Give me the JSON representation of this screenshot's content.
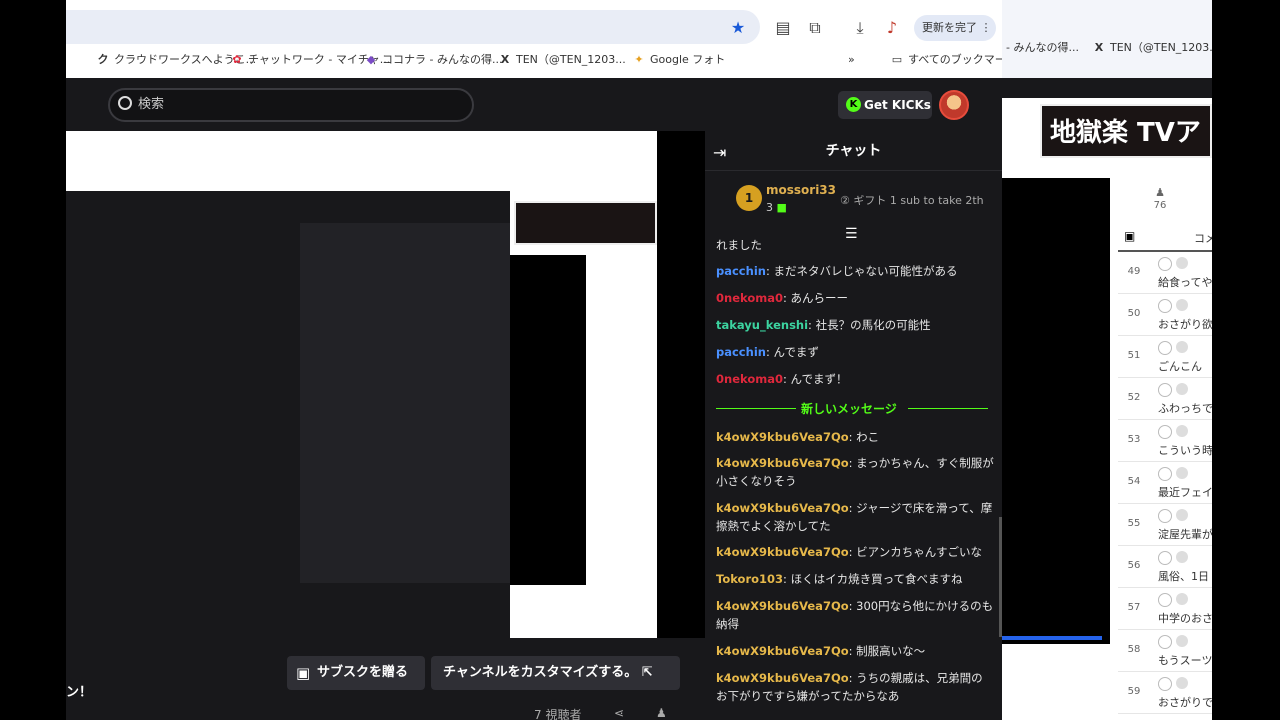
{
  "browser": {
    "update_label": "更新を完了",
    "bookmarks": [
      {
        "icon": "ク",
        "label": "クラウドワークスへようこ..."
      },
      {
        "icon": "✿",
        "label": "チャットワーク - マイチャ..."
      },
      {
        "icon": "◆",
        "label": "ココナラ - みんなの得..."
      },
      {
        "icon": "X",
        "label": "TEN（@TEN_1203..."
      },
      {
        "icon": "✦",
        "label": "Google フォト"
      }
    ],
    "all_bookmarks": "すべてのブックマーク",
    "right_bookmarks": [
      "- みんなの得...",
      "TEN（@TEN_1203..."
    ]
  },
  "kick": {
    "search_placeholder": "検索",
    "get_kicks": "Get KICKs",
    "subscribe_gift": "サブスクを贈る",
    "customize_channel": "チャンネルをカスタマイズする。",
    "viewers": "7 視聴者",
    "left_fragment": "ン！"
  },
  "chat": {
    "title": "チャット",
    "pinned": {
      "user": "mossori33",
      "count": "3",
      "gift_text": "ギフト 1 sub to take 2th"
    },
    "new_messages": "新しいメッセージ",
    "messages": [
      {
        "user": "",
        "text": "れました",
        "color": "#e6e6e6"
      },
      {
        "user": "pacchin",
        "text": ": まだネタバレじゃない可能性がある",
        "color": "#4a90ff"
      },
      {
        "user": "0nekoma0",
        "text": ": あんらーー",
        "color": "#e0283c"
      },
      {
        "user": "takayu_kenshi",
        "text": ": 社長？の馬化の可能性",
        "color": "#3cd4a0"
      },
      {
        "user": "pacchin",
        "text": ": んでまず",
        "color": "#4a90ff"
      },
      {
        "user": "0nekoma0",
        "text": ": んでまず！",
        "color": "#e0283c"
      },
      {
        "user": "k4owX9kbu6Vea7Qo",
        "text": ": わこ",
        "color": "#e6b84a"
      },
      {
        "user": "k4owX9kbu6Vea7Qo",
        "text": ": まっかちゃん、すぐ制服が小さくなりそう",
        "color": "#e6b84a"
      },
      {
        "user": "k4owX9kbu6Vea7Qo",
        "text": ": ジャージで床を滑って、摩擦熱でよく溶かしてた",
        "color": "#e6b84a"
      },
      {
        "user": "k4owX9kbu6Vea7Qo",
        "text": ": ビアンカちゃんすごいな",
        "color": "#e6b84a"
      },
      {
        "user": "Tokoro103",
        "text": ": ほくはイカ焼き買って食べますね",
        "color": "#e6b84a"
      },
      {
        "user": "k4owX9kbu6Vea7Qo",
        "text": ": 300円なら他にかけるのも納得",
        "color": "#e6b84a"
      },
      {
        "user": "k4owX9kbu6Vea7Qo",
        "text": ": 制服高いな〜",
        "color": "#e6b84a"
      },
      {
        "user": "k4owX9kbu6Vea7Qo",
        "text": ": うちの親戚は、兄弟間のお下がりですら嫌がってたからなあ",
        "color": "#e6b84a"
      }
    ]
  },
  "right_panel": {
    "banner": "地獄楽 TVア",
    "viewer_count": "76",
    "col_header": "コメ",
    "rows": [
      {
        "num": "49",
        "text": "給食ってや"
      },
      {
        "num": "50",
        "text": "おさがり欲"
      },
      {
        "num": "51",
        "text": "ごんこん"
      },
      {
        "num": "52",
        "text": "ふわっちで"
      },
      {
        "num": "53",
        "text": "こういう時"
      },
      {
        "num": "54",
        "text": "最近フェイ んですがま"
      },
      {
        "num": "55",
        "text": "淀屋先輩が"
      },
      {
        "num": "56",
        "text": "風俗、1日"
      },
      {
        "num": "57",
        "text": "中学のおさ それで女子"
      },
      {
        "num": "58",
        "text": "もうスーツ"
      },
      {
        "num": "59",
        "text": "おさがりで してビジネ"
      }
    ]
  }
}
